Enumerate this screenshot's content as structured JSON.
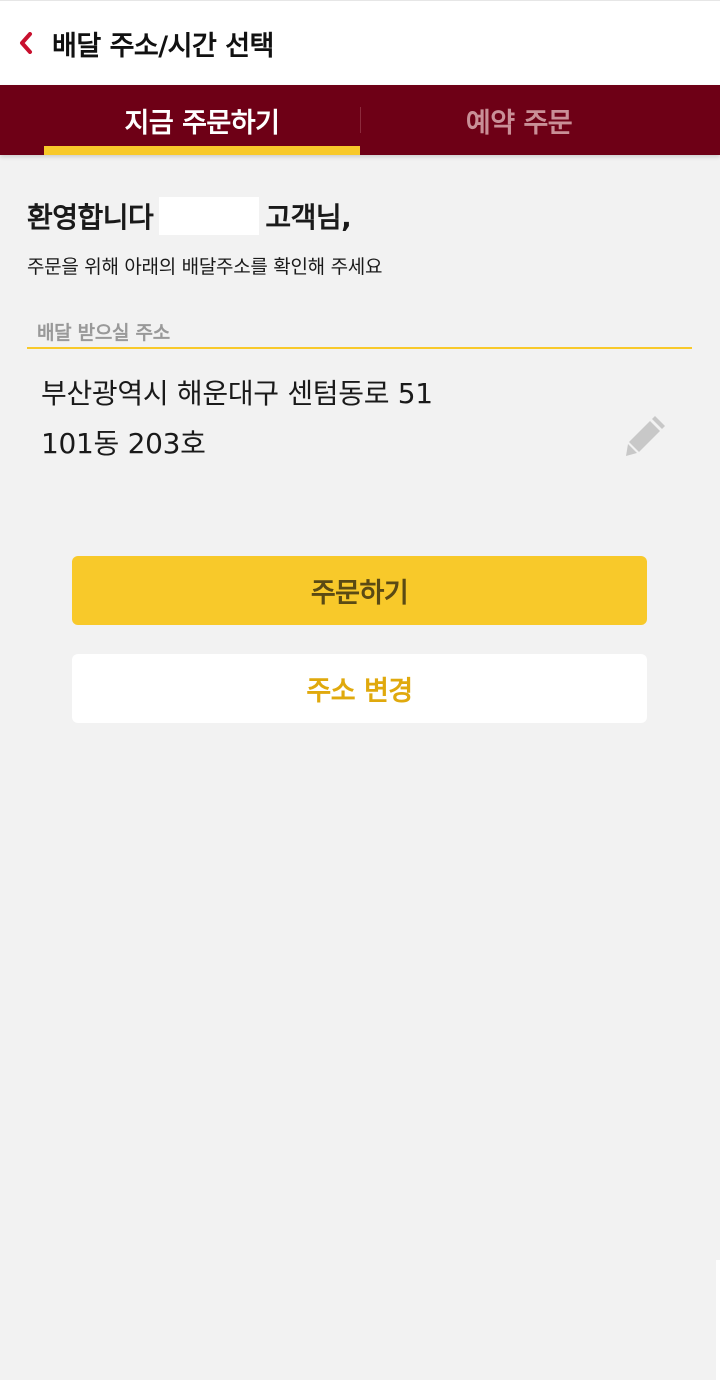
{
  "header": {
    "back_icon": "chevron-left-icon",
    "title": "배달 주소/시간 선택",
    "back_color": "#c8102e"
  },
  "tabs": [
    {
      "label": "지금 주문하기",
      "active": true
    },
    {
      "label": "예약 주문",
      "active": false
    }
  ],
  "welcome": {
    "greeting": "환영합니다",
    "suffix": "고객님,",
    "subtitle": "주문을 위해 아래의 배달주소를 확인해 주세요"
  },
  "address": {
    "label": "배달 받으실 주소",
    "line1": "부산광역시 해운대구 센텀동로 51",
    "line2": "101동 203호",
    "edit_icon": "pencil-icon"
  },
  "buttons": {
    "order_label": "주문하기",
    "change_address_label": "주소 변경"
  },
  "colors": {
    "brand": "#6e0016",
    "accent": "#f8c92a",
    "accent_text": "#e0a90d"
  }
}
